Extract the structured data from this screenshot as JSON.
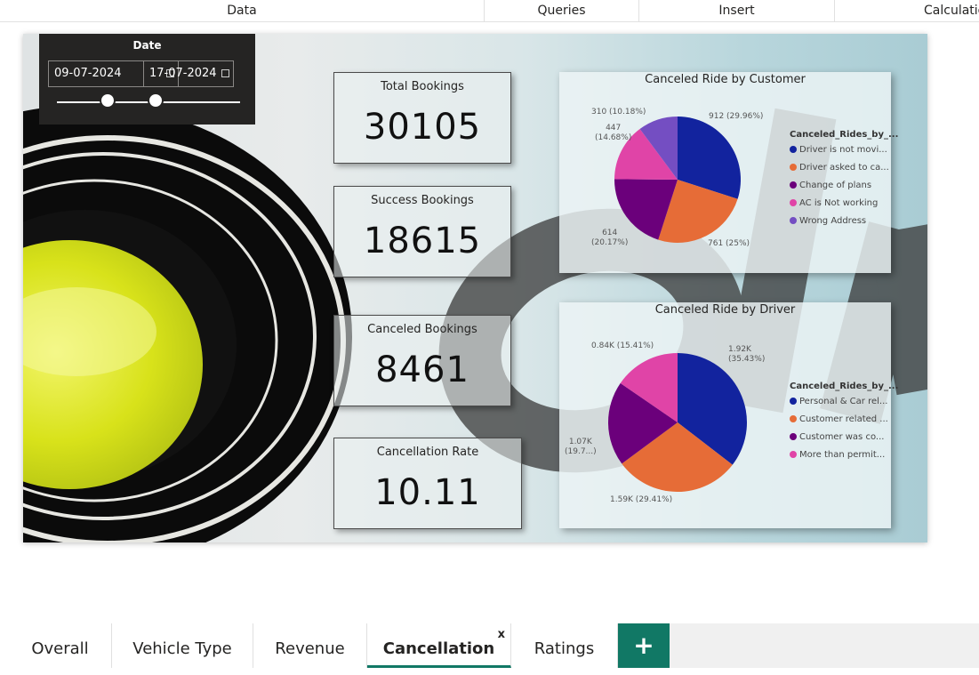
{
  "ribbon": {
    "tabs": [
      {
        "label": "Data"
      },
      {
        "label": "Queries"
      },
      {
        "label": "Insert"
      },
      {
        "label": "Calculations"
      }
    ]
  },
  "slicer": {
    "title": "Date",
    "start": "09-07-2024",
    "end": "17-07-2024"
  },
  "background_text": "OLA",
  "kpis": {
    "total": {
      "title": "Total Bookings",
      "value": "30105"
    },
    "success": {
      "title": "Success Bookings",
      "value": "18615"
    },
    "canceled": {
      "title": "Canceled Bookings",
      "value": "8461"
    },
    "rate": {
      "title": "Cancellation Rate",
      "value": "10.11"
    }
  },
  "customer_chart": {
    "title": "Canceled Ride by Customer",
    "legend_title": "Canceled_Rides_by_...",
    "slices": [
      {
        "legend": "Driver is not movi...",
        "label": "912 (29.96%)",
        "value": 912,
        "color": "#12239E"
      },
      {
        "legend": "Driver asked to ca...",
        "label": "761 (25%)",
        "value": 761,
        "color": "#E66C37"
      },
      {
        "legend": "Change of plans",
        "label1": "614",
        "label2": "(20.17%)",
        "value": 614,
        "color": "#6B007B"
      },
      {
        "legend": "AC is Not working",
        "label1": "447",
        "label2": "(14.68%)",
        "value": 447,
        "color": "#E044A7"
      },
      {
        "legend": "Wrong Address",
        "label": "310 (10.18%)",
        "value": 310,
        "color": "#744EC2"
      }
    ]
  },
  "driver_chart": {
    "title": "Canceled Ride by Driver",
    "legend_title": "Canceled_Rides_by_...",
    "slices": [
      {
        "legend": "Personal & Car rel...",
        "label1": "1.92K",
        "label2": "(35.43%)",
        "value": 35.43,
        "color": "#12239E"
      },
      {
        "legend": "Customer related ...",
        "label": "1.59K (29.41%)",
        "value": 29.41,
        "color": "#E66C37"
      },
      {
        "legend": "Customer was co...",
        "label1": "1.07K",
        "label2": "(19.7...)",
        "value": 19.7,
        "color": "#6B007B"
      },
      {
        "legend": "More than permit...",
        "label": "0.84K (15.41%)",
        "value": 15.41,
        "color": "#E044A7"
      }
    ]
  },
  "page_tabs": [
    {
      "label": "Overall"
    },
    {
      "label": "Vehicle Type"
    },
    {
      "label": "Revenue"
    },
    {
      "label": "Cancellation",
      "active": true
    },
    {
      "label": "Ratings"
    }
  ],
  "close_label": "x",
  "add_label": "+"
}
